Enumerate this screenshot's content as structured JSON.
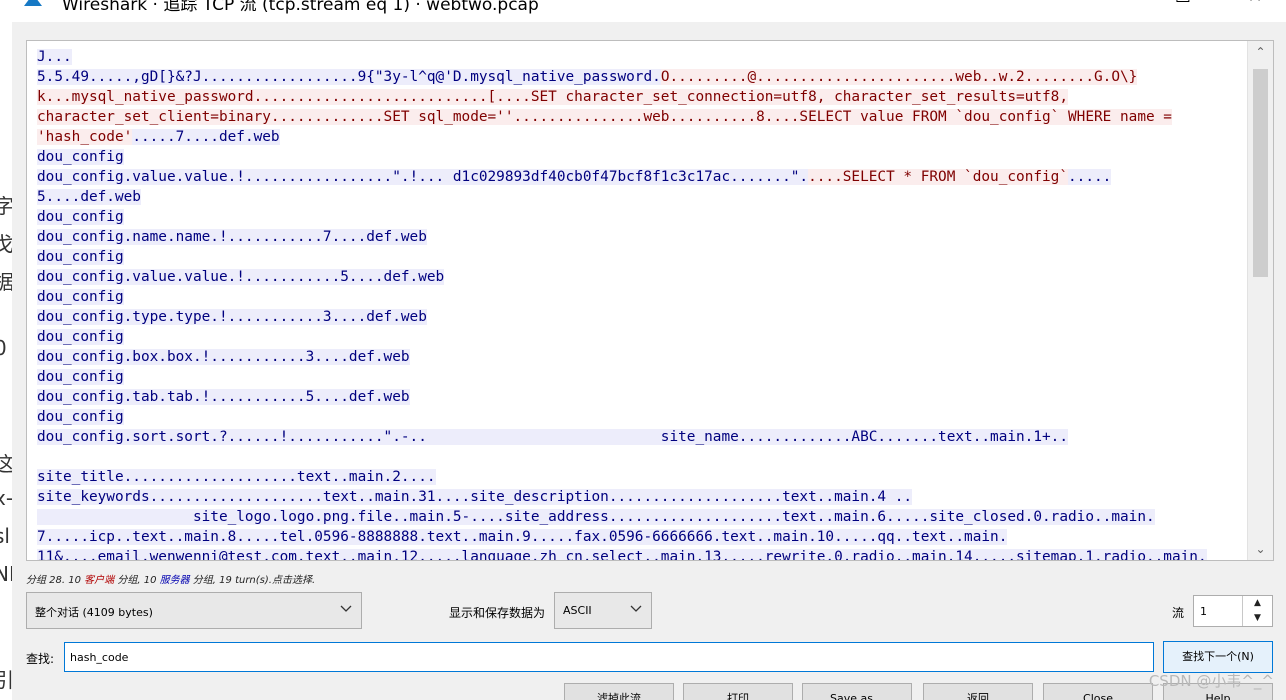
{
  "window": {
    "title": "Wireshark · 追踪 TCP 流 (tcp.stream eq 1) · webtwo.pcap",
    "minimize": "☐",
    "close": "✕"
  },
  "background_fragments": [
    "字",
    "戈",
    "据",
    "0",
    "这",
    "x-",
    "sl",
    "NI",
    "引"
  ],
  "stream": {
    "lines": [
      [
        {
          "t": "J...",
          "k": "s"
        }
      ],
      [
        {
          "t": "5.5.49.....,gD[}&?J..................9{\"3y-l^q@'D.mysql_native_password.",
          "k": "s"
        },
        {
          "t": "O.........@.......................web..w.2........G.O\\}",
          "k": "c"
        }
      ],
      [
        {
          "t": "k...mysql_native_password...........................[....SET character_set_connection=utf8, character_set_results=utf8,",
          "k": "c"
        }
      ],
      [
        {
          "t": "character_set_client=binary.............SET sql_mode=''...............web..........8....SELECT value FROM `dou_config` WHERE name =",
          "k": "c"
        }
      ],
      [
        {
          "t": "'hash_code'",
          "k": "c"
        },
        {
          "t": ".....7....def.web",
          "k": "s"
        }
      ],
      [
        {
          "t": "dou_config",
          "k": "s"
        }
      ],
      [
        {
          "t": "dou_config.value.value.!.................\".!... d1c029893df40cb0f47bcf8f1c3c17ac.......\".",
          "k": "s"
        },
        {
          "t": "....SELECT * FROM `dou_config`",
          "k": "c"
        },
        {
          "t": ".....",
          "k": "s"
        }
      ],
      [
        {
          "t": "5....def.web",
          "k": "s"
        }
      ],
      [
        {
          "t": "dou_config",
          "k": "s"
        }
      ],
      [
        {
          "t": "dou_config.name.name.!...........7....def.web",
          "k": "s"
        }
      ],
      [
        {
          "t": "dou_config",
          "k": "s"
        }
      ],
      [
        {
          "t": "dou_config.value.value.!...........5....def.web",
          "k": "s"
        }
      ],
      [
        {
          "t": "dou_config",
          "k": "s"
        }
      ],
      [
        {
          "t": "dou_config.type.type.!...........3....def.web",
          "k": "s"
        }
      ],
      [
        {
          "t": "dou_config",
          "k": "s"
        }
      ],
      [
        {
          "t": "dou_config.box.box.!...........3....def.web",
          "k": "s"
        }
      ],
      [
        {
          "t": "dou_config",
          "k": "s"
        }
      ],
      [
        {
          "t": "dou_config.tab.tab.!...........5....def.web",
          "k": "s"
        }
      ],
      [
        {
          "t": "dou_config",
          "k": "s"
        }
      ],
      [
        {
          "t": "dou_config.sort.sort.?......!...........\".-..                           site_name.............ABC.......text..main.1+..",
          "k": "s"
        }
      ],
      [],
      [
        {
          "t": "site_title....................text..main.2....",
          "k": "s"
        }
      ],
      [
        {
          "t": "site_keywords....................text..main.31....site_description....................text..main.4 ..",
          "k": "s"
        }
      ],
      [
        {
          "t": "                  site_logo.logo.png.file..main.5-....site_address....................text..main.6.....site_closed.0.radio..main.",
          "k": "s"
        }
      ],
      [
        {
          "t": "7.....icp..text..main.8.....tel.0596-8888888.text..main.9.....fax.0596-6666666.text..main.10.....qq..text..main.",
          "k": "s"
        }
      ],
      [
        {
          "t": "11&....email.wenwenni@test.com.text..main.12.....language.zh_cn.select..main.13.....rewrite.0.radio..main.14.....sitemap.1.radio..main.",
          "k": "s"
        }
      ]
    ]
  },
  "stats": {
    "prefix": "分组 28. 10 ",
    "client": "客户端",
    "middle": " 分组, 10 ",
    "server": "服务器",
    "suffix": " 分组, 19 turn(s).点击选择."
  },
  "conversation_select": {
    "value": "整个对话 (4109 bytes)"
  },
  "show_as": {
    "label": "显示和保存数据为",
    "value": "ASCII"
  },
  "stream_spin": {
    "label": "流",
    "value": "1"
  },
  "find": {
    "label": "查找:",
    "value": "hash_code",
    "button": "查找下一个(N)"
  },
  "buttons": [
    "滤掉此流",
    "打印",
    "Save as…",
    "返回",
    "Close",
    "Help"
  ],
  "watermark": "CSDN @小韦^_^"
}
